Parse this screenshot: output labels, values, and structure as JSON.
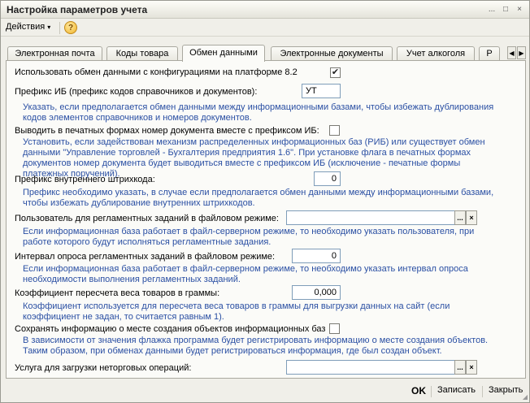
{
  "window": {
    "title": "Настройка параметров учета",
    "title_buttons": [
      "...",
      "□",
      "×"
    ]
  },
  "menubar": {
    "actions_label": "Действия",
    "actions_arrow": "▾",
    "help_glyph": "?"
  },
  "tabs": [
    {
      "label": "Электронная почта",
      "active": false
    },
    {
      "label": "Коды товара",
      "active": false
    },
    {
      "label": "Обмен данными",
      "active": true
    },
    {
      "label": "Электронные документы",
      "active": false
    },
    {
      "label": "Учет алкоголя",
      "active": false
    },
    {
      "label": "Р",
      "active": false
    }
  ],
  "tab_nav": [
    "◀",
    "▶"
  ],
  "exchange": {
    "use_82_label": "Использовать обмен данными с конфигурациями на платформе 8.2",
    "use_82_checked": "✔",
    "prefix_label": "Префикс ИБ (префикс кодов справочников и документов):",
    "prefix_value": "УТ",
    "prefix_hint": "Указать, если предполагается обмен данными между информационными базами, чтобы избежать дублирования кодов элементов справочников и номеров документов.",
    "print_prefix_label": "Выводить в печатных формах номер документа вместе с префиксом ИБ:",
    "print_prefix_checked": "",
    "print_prefix_hint": "Установить, если задействован механизм распределенных информационных баз (РИБ) или существует обмен данными \"Управление торговлей - Бухгалтерия предприятия 1.6\". При установке флага в печатных формах документов номер документа будет выводиться вместе с префиксом ИБ (исключение - печатные формы платежных поручений).",
    "barcode_prefix_label": "Префикс внутреннего штрихкода:",
    "barcode_prefix_value": "0",
    "barcode_prefix_hint": "Префикс необходимо указать, в случае если предполагается обмен данными между информационными базами, чтобы избежать дублирование внутренних штрихкодов.",
    "sched_user_label": "Пользователь для регламентных заданий в файловом режиме:",
    "sched_user_value": "",
    "sched_user_hint": "Если информационная база работает в файл-серверном режиме, то необходимо указать пользователя, при работе которого будут исполняться регламентные задания.",
    "poll_interval_label": "Интервал опроса регламентных заданий в файловом режиме:",
    "poll_interval_value": "0",
    "poll_interval_hint": "Если информационная база работает в файл-серверном режиме, то необходимо указать интервал опроса необходимости выполнения регламентных заданий.",
    "weight_coef_label": "Коэффициент пересчета веса товаров в граммы:",
    "weight_coef_value": "0,000",
    "weight_coef_hint": "Коэффициент используется для пересчета веса товаров в граммы для выгрузки данных на сайт (если коэффициент не задан, то считается равным 1).",
    "save_origin_label": "Сохранять информацию о месте создания объектов информационных баз",
    "save_origin_checked": "",
    "save_origin_hint": "В зависимости от значения флажка программа будет регистрировать информацию о месте создания объектов. Таким образом, при обменах данными будет регистрироваться информация, где был создан объект.",
    "service_label": "Услуга для загрузки неторговых операций:",
    "service_value": ""
  },
  "field_buttons": {
    "select": "...",
    "clear": "×"
  },
  "footer": {
    "ok": "OK",
    "save": "Записать",
    "close": "Закрыть"
  },
  "colors": {
    "hint_text": "#2a4fa3",
    "field_border": "#7f9db9"
  }
}
